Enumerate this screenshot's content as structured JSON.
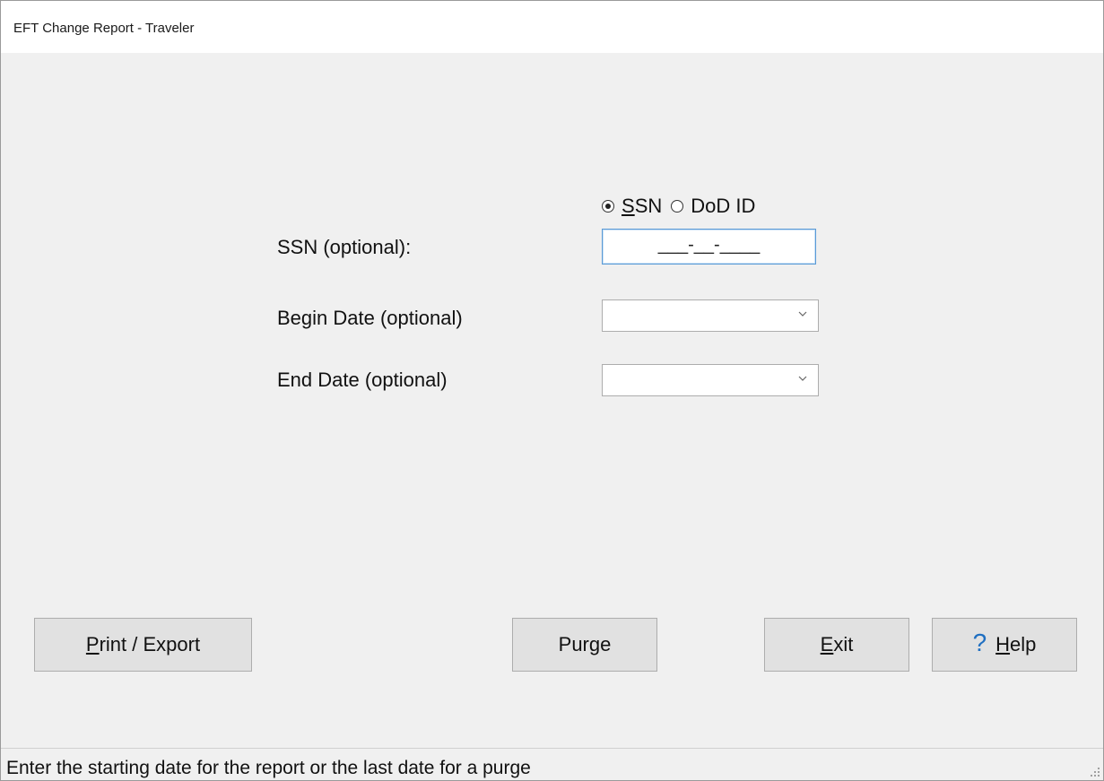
{
  "window": {
    "title": "EFT Change Report - Traveler"
  },
  "id_type": {
    "options": [
      {
        "label_underlined": "S",
        "label_rest": "SSN",
        "checked": true
      },
      {
        "label": "DoD ID",
        "checked": false
      }
    ]
  },
  "form": {
    "ssn_label": "SSN (optional):",
    "ssn_value": "___-__-____",
    "begin_date_label": "Begin Date (optional)",
    "begin_date_value": "",
    "end_date_label": "End Date (optional)",
    "end_date_value": ""
  },
  "buttons": {
    "print_export": {
      "mnemonic": "P",
      "rest": "rint / Export"
    },
    "purge": {
      "label": "Purge"
    },
    "exit": {
      "mnemonic": "E",
      "rest": "xit"
    },
    "help": {
      "icon": "?",
      "mnemonic": "H",
      "rest": "elp"
    }
  },
  "statusbar": {
    "text": "Enter the starting date for the report or the last date for a purge"
  },
  "colors": {
    "background": "#f0f0f0",
    "focus_border": "#5a9ad6",
    "help_icon": "#1f6fc1"
  }
}
